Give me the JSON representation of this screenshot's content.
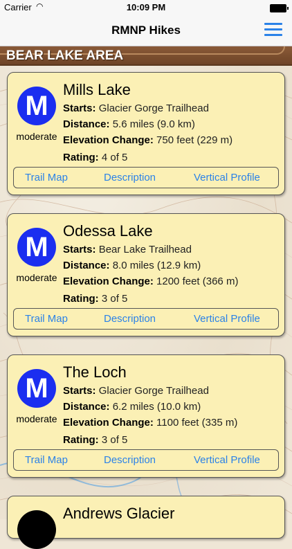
{
  "status_bar": {
    "carrier": "Carrier",
    "time": "10:09 PM",
    "wifi_icon": "wifi-icon",
    "battery_icon": "battery-icon"
  },
  "nav": {
    "title": "RMNP Hikes",
    "menu_icon": "menu-icon",
    "accent_color": "#2b82e8"
  },
  "section": {
    "title": "BEAR LAKE AREA"
  },
  "labels": {
    "starts": "Starts:",
    "distance": "Distance:",
    "elevation": "Elevation Change:",
    "rating": "Rating:"
  },
  "hikes": [
    {
      "badge": "M",
      "difficulty": "moderate",
      "name": "Mills Lake",
      "starts": "Glacier Gorge Trailhead",
      "distance": "5.6 miles (9.0 km)",
      "elevation": "750 feet (229 m)",
      "rating": "4 of 5",
      "links": [
        "Trail Map",
        "Description",
        "Vertical Profile"
      ]
    },
    {
      "badge": "M",
      "difficulty": "moderate",
      "name": "Odessa Lake",
      "starts": "Bear Lake Trailhead",
      "distance": "8.0 miles (12.9 km)",
      "elevation": "1200 feet (366 m)",
      "rating": "3 of 5",
      "links": [
        "Trail Map",
        "Description",
        "Vertical Profile"
      ]
    },
    {
      "badge": "M",
      "difficulty": "moderate",
      "name": "The Loch",
      "starts": "Glacier Gorge Trailhead",
      "distance": "6.2 miles (10.0 km)",
      "elevation": "1100 feet (335 m)",
      "rating": "3 of 5",
      "links": [
        "Trail Map",
        "Description",
        "Vertical Profile"
      ]
    },
    {
      "name": "Andrews Glacier"
    }
  ]
}
